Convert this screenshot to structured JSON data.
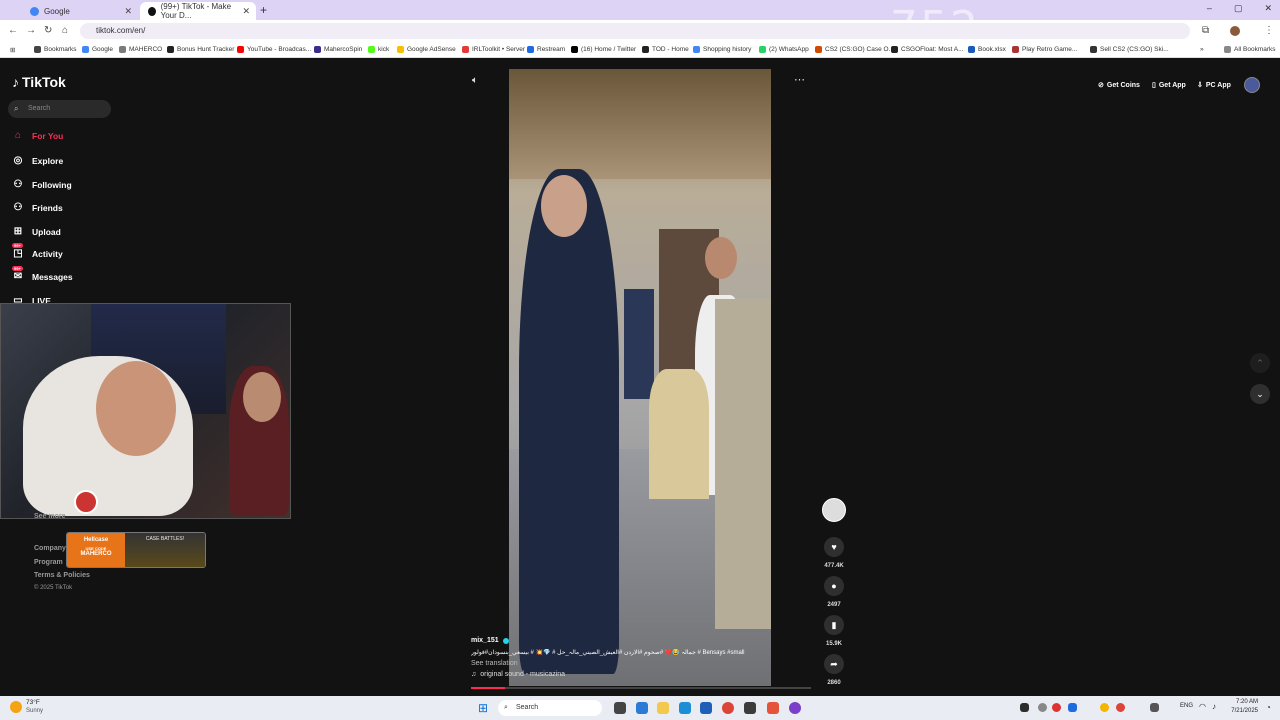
{
  "browser": {
    "tabs": [
      {
        "title": "Google",
        "close": "✕",
        "color": "#4285f4"
      },
      {
        "title": "(99+) TikTok - Make Your D...",
        "close": "✕",
        "color": "#111111"
      }
    ],
    "new_tab": "+",
    "window_controls": [
      "–",
      "▢",
      "✕"
    ],
    "overlay_number": "752",
    "url": "tiktok.com/en/",
    "nav": {
      "back": "←",
      "forward": "→",
      "reload": "↻",
      "home": "⌂"
    },
    "bookmarks": [
      {
        "label": "Bookmarks",
        "color": "#444444"
      },
      {
        "label": "Google",
        "color": "#4285f4"
      },
      {
        "label": "MAHERCO",
        "color": "#7a7a7a"
      },
      {
        "label": "Bonus Hunt Tracker",
        "color": "#222222"
      },
      {
        "label": "YouTube - Broadcas...",
        "color": "#ff0000"
      },
      {
        "label": "MahercoSpin",
        "color": "#3b2b8c"
      },
      {
        "label": "kick",
        "color": "#53fc18"
      },
      {
        "label": "Google AdSense",
        "color": "#fbbc04"
      },
      {
        "label": "IRLToolkit • Server",
        "color": "#e53935"
      },
      {
        "label": "Restream",
        "color": "#1e6ae1"
      },
      {
        "label": "(16) Home / Twitter",
        "color": "#000000"
      },
      {
        "label": "TOD - Home",
        "color": "#222222"
      },
      {
        "label": "Shopping history",
        "color": "#4285f4"
      },
      {
        "label": "(2) WhatsApp",
        "color": "#25d366"
      },
      {
        "label": "CS2 (CS:GO) Case O...",
        "color": "#d04a02"
      },
      {
        "label": "CSGOFloat: Most A...",
        "color": "#222222"
      },
      {
        "label": "Book.xlsx",
        "color": "#185abd"
      },
      {
        "label": "Play Retro Game...",
        "color": "#aa3333"
      },
      {
        "label": "Sell CS2 (CS:GO) Ski...",
        "color": "#333333"
      }
    ],
    "all_bookmarks": "All Bookmarks"
  },
  "sidebar": {
    "logo": "TikTok",
    "search_placeholder": "Search",
    "items": [
      {
        "label": "For You",
        "icon": "⌂",
        "active": true
      },
      {
        "label": "Explore",
        "icon": "◎"
      },
      {
        "label": "Following",
        "icon": "⚇"
      },
      {
        "label": "Friends",
        "icon": "⚇"
      },
      {
        "label": "Upload",
        "icon": "⊞"
      },
      {
        "label": "Activity",
        "icon": "◳",
        "badge": "99+"
      },
      {
        "label": "Messages",
        "icon": "✉",
        "badge": "99+"
      },
      {
        "label": "LIVE",
        "icon": "▭"
      }
    ],
    "see_more": "See more",
    "footer": [
      "Company",
      "Program",
      "Terms & Policies",
      "© 2025 TikTok"
    ],
    "ad": {
      "brand": "Hellcase",
      "code_label": "USE CODE",
      "code": "MAHERCO",
      "right": "CASE BATTLES!"
    }
  },
  "header": {
    "get_coins": "Get Coins",
    "get_app": "Get App",
    "pc_app": "PC App"
  },
  "video": {
    "username": "mix_151",
    "caption": "جمالہ 😂❤️ #صحوم #الاردن #العيش_الصيني_مالہ_حل # 💎💥 # بيسعي_بنسودان#فولور # Bensays #small",
    "see_translation": "See translation",
    "sound": "original sound - musicazina",
    "progress": 0.1,
    "likes": "477.4K",
    "comments": "2497",
    "saves": "15.9K",
    "shares": "2860"
  },
  "taskbar": {
    "weather_temp": "73°F",
    "weather_desc": "Sunny",
    "search": "Search",
    "lang": "ENG",
    "time": "7:20 AM",
    "date": "7/21/2025"
  }
}
